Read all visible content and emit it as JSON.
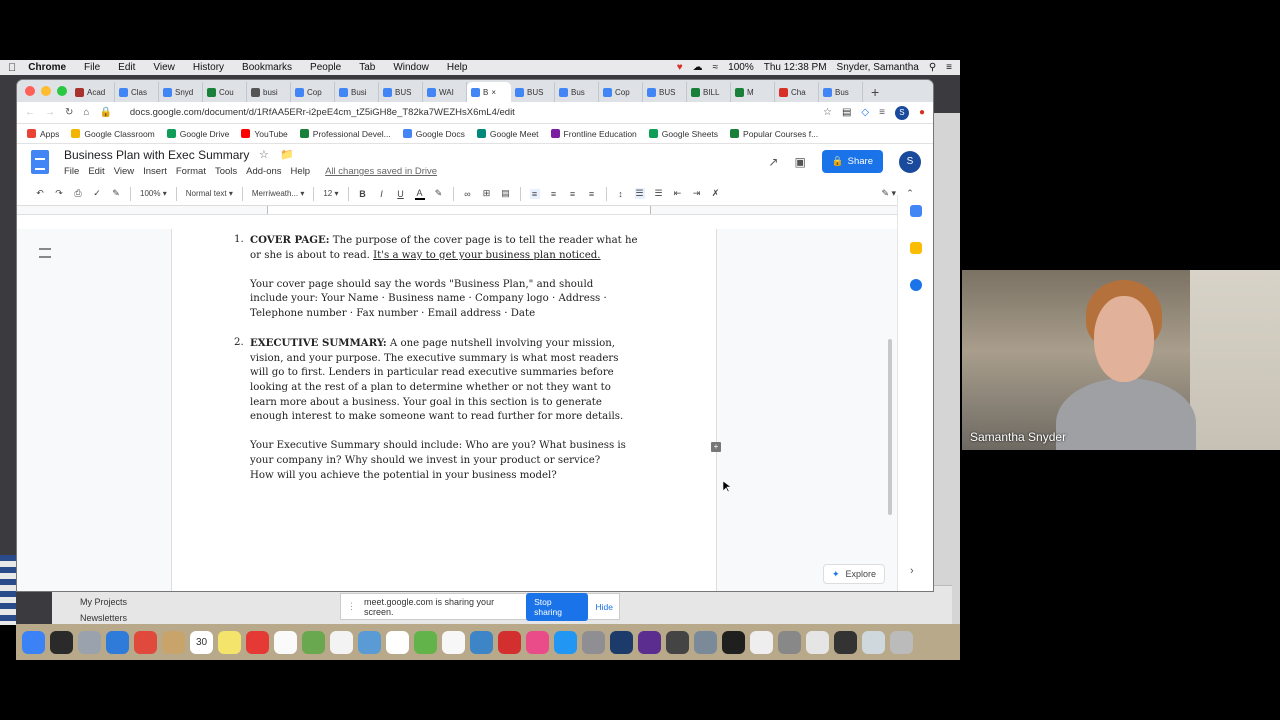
{
  "menubar": {
    "items": [
      "Chrome",
      "File",
      "Edit",
      "View",
      "History",
      "Bookmarks",
      "People",
      "Tab",
      "Window",
      "Help"
    ],
    "battery": "100%",
    "clock": "Thu 12:38 PM",
    "user": "Snyder, Samantha"
  },
  "browser": {
    "tabs": [
      {
        "label": "Acad",
        "color": "#a8322d"
      },
      {
        "label": "Clas",
        "color": "#4285f4"
      },
      {
        "label": "Snyd",
        "color": "#4285f4"
      },
      {
        "label": "Cou",
        "color": "#188038"
      },
      {
        "label": "busi",
        "color": "#555555"
      },
      {
        "label": "Cop",
        "color": "#4285f4"
      },
      {
        "label": "Busi",
        "color": "#4285f4"
      },
      {
        "label": "BUS",
        "color": "#4285f4"
      },
      {
        "label": "WAI",
        "color": "#4285f4"
      },
      {
        "label": "B",
        "color": "#4285f4",
        "active": true
      },
      {
        "label": "BUS",
        "color": "#4285f4"
      },
      {
        "label": "Bus",
        "color": "#4285f4"
      },
      {
        "label": "Cop",
        "color": "#4285f4"
      },
      {
        "label": "BUS",
        "color": "#4285f4"
      },
      {
        "label": "BILL",
        "color": "#188038"
      },
      {
        "label": "M",
        "color": "#188038"
      },
      {
        "label": "Cha",
        "color": "#d93025"
      },
      {
        "label": "Bus",
        "color": "#4285f4"
      }
    ],
    "url": "docs.google.com/document/d/1RfAA5ERr-i2peE4cm_tZ5iGH8e_T82ka7WEZHsX6mL4/edit",
    "bookmarks": [
      {
        "label": "Apps",
        "color": "#ea4335"
      },
      {
        "label": "Google Classroom",
        "color": "#f4b400"
      },
      {
        "label": "Google Drive",
        "color": "#0f9d58"
      },
      {
        "label": "YouTube",
        "color": "#ff0000"
      },
      {
        "label": "Professional Devel...",
        "color": "#188038"
      },
      {
        "label": "Google Docs",
        "color": "#4285f4"
      },
      {
        "label": "Google Meet",
        "color": "#00897b"
      },
      {
        "label": "Frontline Education",
        "color": "#7b1fa2"
      },
      {
        "label": "Google Sheets",
        "color": "#0f9d58"
      },
      {
        "label": "Popular Courses f...",
        "color": "#188038"
      }
    ]
  },
  "docs": {
    "title": "Business Plan with Exec Summary",
    "menu": [
      "File",
      "Edit",
      "View",
      "Insert",
      "Format",
      "Tools",
      "Add-ons",
      "Help"
    ],
    "saved_status": "All changes saved in Drive",
    "share_label": "Share",
    "avatar_letter": "S",
    "toolbar": {
      "zoom": "100%",
      "style": "Normal text",
      "font": "Merriweath...",
      "size": "12"
    },
    "content": {
      "item1_num": "1.",
      "item1_heading": "COVER PAGE:",
      "item1_line1_rest": " The purpose of the cover page is to tell the reader what he",
      "item1_line2_a": "or she is about to read. ",
      "item1_line2_underlined": "It's a way to get your business plan noticed.",
      "item1_para2_line1": "Your cover page should say the words \"Business Plan,\" and should",
      "item1_para2_line2": "include your: Your Name · Business name · Company logo · Address ·",
      "item1_para2_line3": "Telephone number · Fax number · Email address · Date",
      "item2_num": "2.",
      "item2_heading": "EXECUTIVE SUMMARY:",
      "item2_line1_rest": " A one page nutshell involving your mission,",
      "item2_line2": "vision, and your purpose. The executive summary is what most readers",
      "item2_line3": "will go to first. Lenders in particular read executive summaries before",
      "item2_line4": "looking at the rest of a plan to determine whether or not they want to",
      "item2_line5": "learn more about a business. Your goal in this section is to generate",
      "item2_line6": "enough interest to make someone want to read further for more details.",
      "item2_para2_line1": "Your Executive Summary should include: Who are you?  What business is",
      "item2_para2_line2": "your company in?  Why should we invest in your product or service?",
      "item2_para2_line3": "How will you achieve the potential in your business model?"
    },
    "explore_label": "Explore"
  },
  "desktop": {
    "panel_rows": [
      "My Projects",
      "Newsletters"
    ]
  },
  "screen_share": {
    "message": "meet.google.com is sharing your screen.",
    "stop_label": "Stop sharing",
    "hide_label": "Hide"
  },
  "video": {
    "participant_name": "Samantha Snyder"
  },
  "dock": {
    "calendar_day": "30",
    "colors": [
      "#3b82f6",
      "#2a2a2a",
      "#9aa3ad",
      "#2f7bd9",
      "#e04a3c",
      "#c8a46b",
      "#ffffff",
      "#f5e46b",
      "#e53935",
      "#fafafa",
      "#6aa84f",
      "#f3f3f3",
      "#5b9bd5",
      "#ffffff",
      "#62b34a",
      "#f7f7f7",
      "#3d85c6",
      "#d32f2f",
      "#ea4c89",
      "#2196f3",
      "#8e8e93",
      "#1d3b6a",
      "#5b2d8e",
      "#444444",
      "#7a8a99",
      "#1f1f1f",
      "#eeeeee",
      "#888888",
      "#e5e5e5",
      "#333333",
      "#cfd8dc",
      "#bbbbbb"
    ]
  }
}
